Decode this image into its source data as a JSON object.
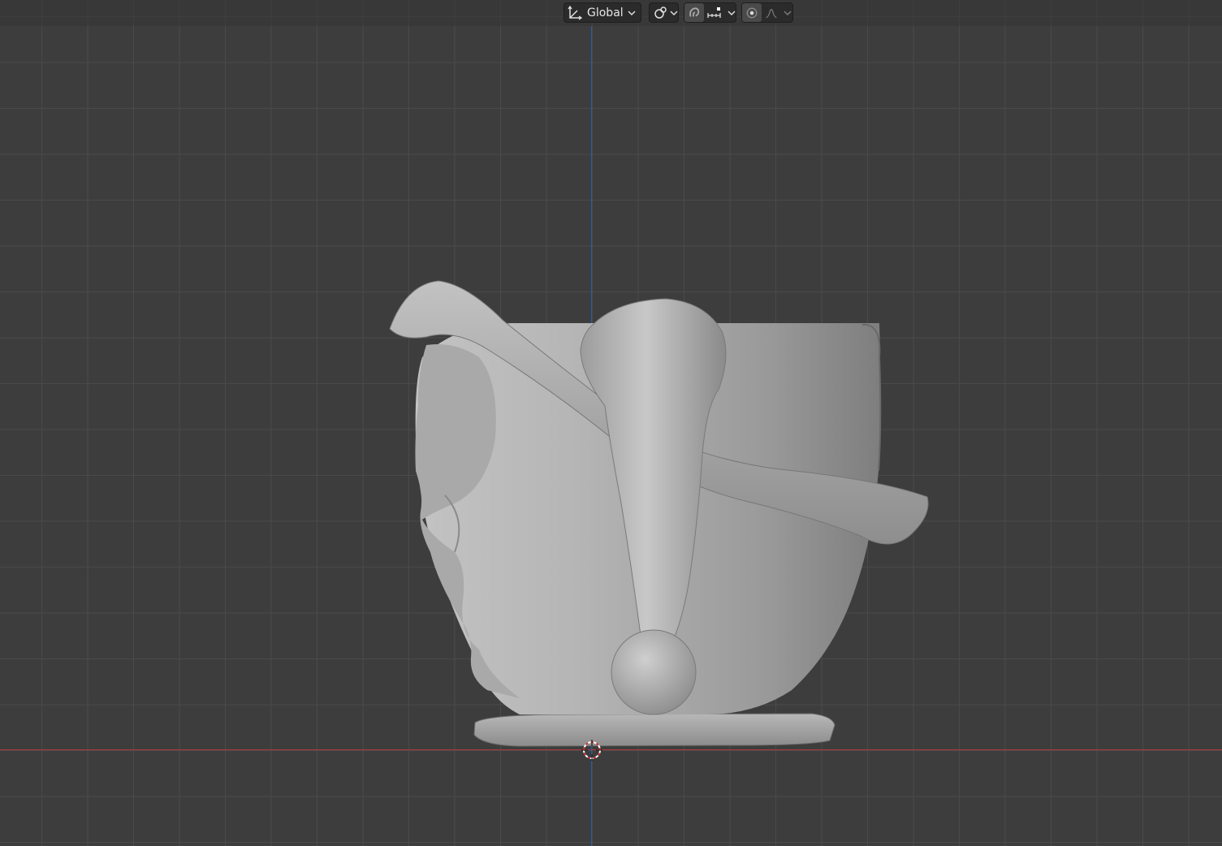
{
  "app": "Blender",
  "header": {
    "transform_orientation": {
      "label": "Global",
      "icon": "transform-orientation-icon"
    },
    "pivot_point": {
      "icon": "pivot-point-icon"
    },
    "snapping": {
      "toggle_icon": "snap-magnet-icon",
      "snap_target_icon": "snap-increment-icon"
    },
    "proportional_editing": {
      "toggle_icon": "proportional-edit-icon",
      "falloff_icon": "proportional-falloff-icon"
    }
  },
  "viewport": {
    "view": "orthographic-front",
    "object": "teacup-character-mesh",
    "cursor": "3d-cursor",
    "colors": {
      "background": "#3d3d3d",
      "grid": "#4a4a4a",
      "x_axis": "#b03a3a",
      "z_axis": "#2c5aa8",
      "mesh": "#a6a6a6"
    }
  }
}
